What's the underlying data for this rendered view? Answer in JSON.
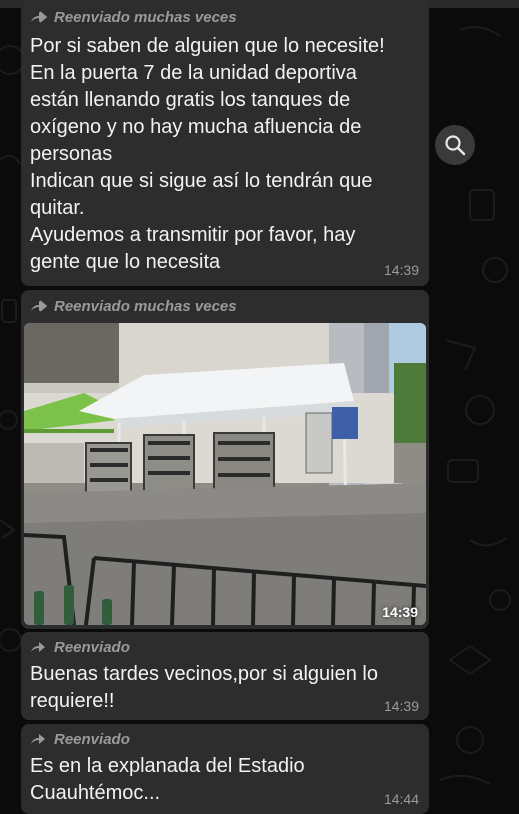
{
  "messages": [
    {
      "forwarded_label": "Reenviado muchas veces",
      "lines": [
        "Por si saben de alguien que lo necesite!",
        "En la puerta 7 de la unidad deportiva",
        "están llenando gratis los tanques de",
        "oxígeno y no hay mucha afluencia de",
        "personas",
        "Indican que si sigue así lo tendrán que",
        "quitar.",
        "Ayudemos a transmitir por favor, hay",
        "gente que lo necesita"
      ],
      "time": "14:39"
    },
    {
      "forwarded_label": "Reenviado muchas veces",
      "time": "14:39"
    },
    {
      "forwarded_label": "Reenviado",
      "lines": [
        "Buenas tardes vecinos,por si alguien lo",
        "requiere!!"
      ],
      "time": "14:39"
    },
    {
      "forwarded_label": "Reenviado",
      "lines": [
        "Es en la explanada del Estadio",
        "Cuauhtémoc..."
      ],
      "time": "14:44"
    }
  ],
  "search_button": {
    "icon": "search-icon"
  },
  "colors": {
    "background": "#0b0b0b",
    "bubble": "#2d2d2e",
    "text": "#f2f2f2",
    "meta": "#9a9a9c"
  }
}
